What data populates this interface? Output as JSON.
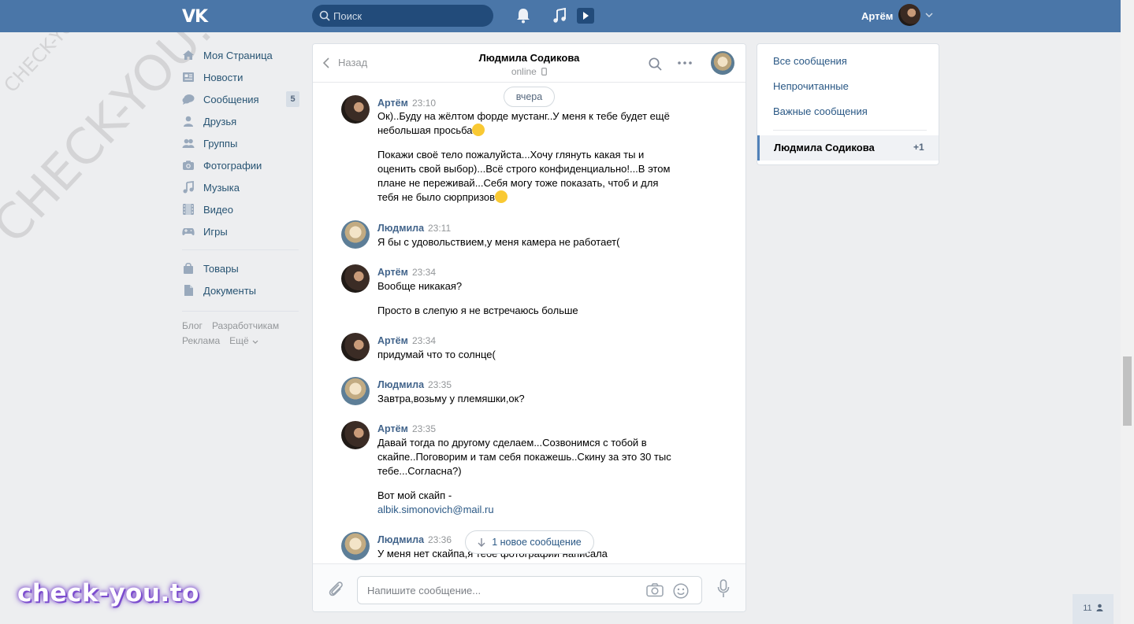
{
  "header": {
    "logo": "VK",
    "search_placeholder": "Поиск",
    "user_name": "Артём"
  },
  "left_menu": {
    "items": [
      {
        "label": "Моя Страница",
        "icon": "home-icon"
      },
      {
        "label": "Новости",
        "icon": "news-icon"
      },
      {
        "label": "Сообщения",
        "icon": "messages-icon",
        "count": "5"
      },
      {
        "label": "Друзья",
        "icon": "friends-icon"
      },
      {
        "label": "Группы",
        "icon": "groups-icon"
      },
      {
        "label": "Фотографии",
        "icon": "camera-icon"
      },
      {
        "label": "Музыка",
        "icon": "music-note-icon"
      },
      {
        "label": "Видео",
        "icon": "film-icon"
      },
      {
        "label": "Игры",
        "icon": "gamepad-icon"
      }
    ],
    "items2": [
      {
        "label": "Товары",
        "icon": "bag-icon"
      },
      {
        "label": "Документы",
        "icon": "document-icon"
      }
    ],
    "footer": {
      "blog": "Блог",
      "developers": "Разработчикам",
      "ads": "Реклама",
      "more": "Ещё"
    }
  },
  "chat": {
    "back_label": "Назад",
    "peer_name": "Людмила Содикова",
    "peer_status": "online",
    "day_label": "вчера",
    "messages": [
      {
        "author": "Артём",
        "time": "23:10",
        "paragraphs": [
          "Ок)..Буду на жёлтом форде мустанг..У меня к тебе будет ещё небольшая просьба",
          "Покажи своё тело пожалуйста...Хочу глянуть какая ты и оценить свой выбор)...Всё строго конфиденциально!...В этом плане не переживай...Себя могу тоже показать, чтоб и для тебя не было сюрпризов"
        ]
      },
      {
        "author": "Людмила",
        "time": "23:11",
        "paragraphs": [
          "Я бы с удовольствием,у меня камера не работает("
        ]
      },
      {
        "author": "Артём",
        "time": "23:34",
        "paragraphs": [
          "Вообще никакая?",
          "Просто в слепую я не встречаюсь больше"
        ]
      },
      {
        "author": "Артём",
        "time": "23:34",
        "paragraphs": [
          "придумай что то солнце("
        ]
      },
      {
        "author": "Людмила",
        "time": "23:35",
        "paragraphs": [
          "Завтра,возьму у племяшки,ок?"
        ]
      },
      {
        "author": "Артём",
        "time": "23:35",
        "paragraphs": [
          "Давай тогда по другому сделаем...Созвонимся с тобой в скайпе..Поговорим и там себя покажешь..Скину за это 30 тыс тебе...Согласна?)",
          "Вот мой скайп -"
        ],
        "link": "albik.simonovich@mail.ru"
      },
      {
        "author": "Людмила",
        "time": "23:36",
        "paragraphs": [
          "У меня нет скайпа,я тебе фотографии написала"
        ]
      }
    ],
    "new_message_label": "1 новое сообщение",
    "composer_placeholder": "Напишите сообщение..."
  },
  "right_panel": {
    "all_messages": "Все сообщения",
    "unread": "Непрочитанные",
    "important": "Важные сообщения",
    "active_dialog": "Людмила Содикова",
    "active_count": "+1"
  },
  "online_count": "11",
  "watermarks": {
    "site": "check-you.to",
    "diagonal_large": "CHECK-YOU.ME",
    "diagonal_small": "CHECK-YOU.ME"
  },
  "colors": {
    "header": "#4a76a8",
    "link": "#2a5885",
    "author": "#42648b",
    "background": "#edeef0"
  }
}
